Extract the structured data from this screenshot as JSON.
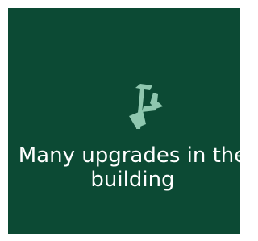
{
  "tile": {
    "background_color": "#0c4a34",
    "icon": "nail-icon",
    "icon_color": "#8fc7af",
    "caption": "Many upgrades in the building"
  }
}
